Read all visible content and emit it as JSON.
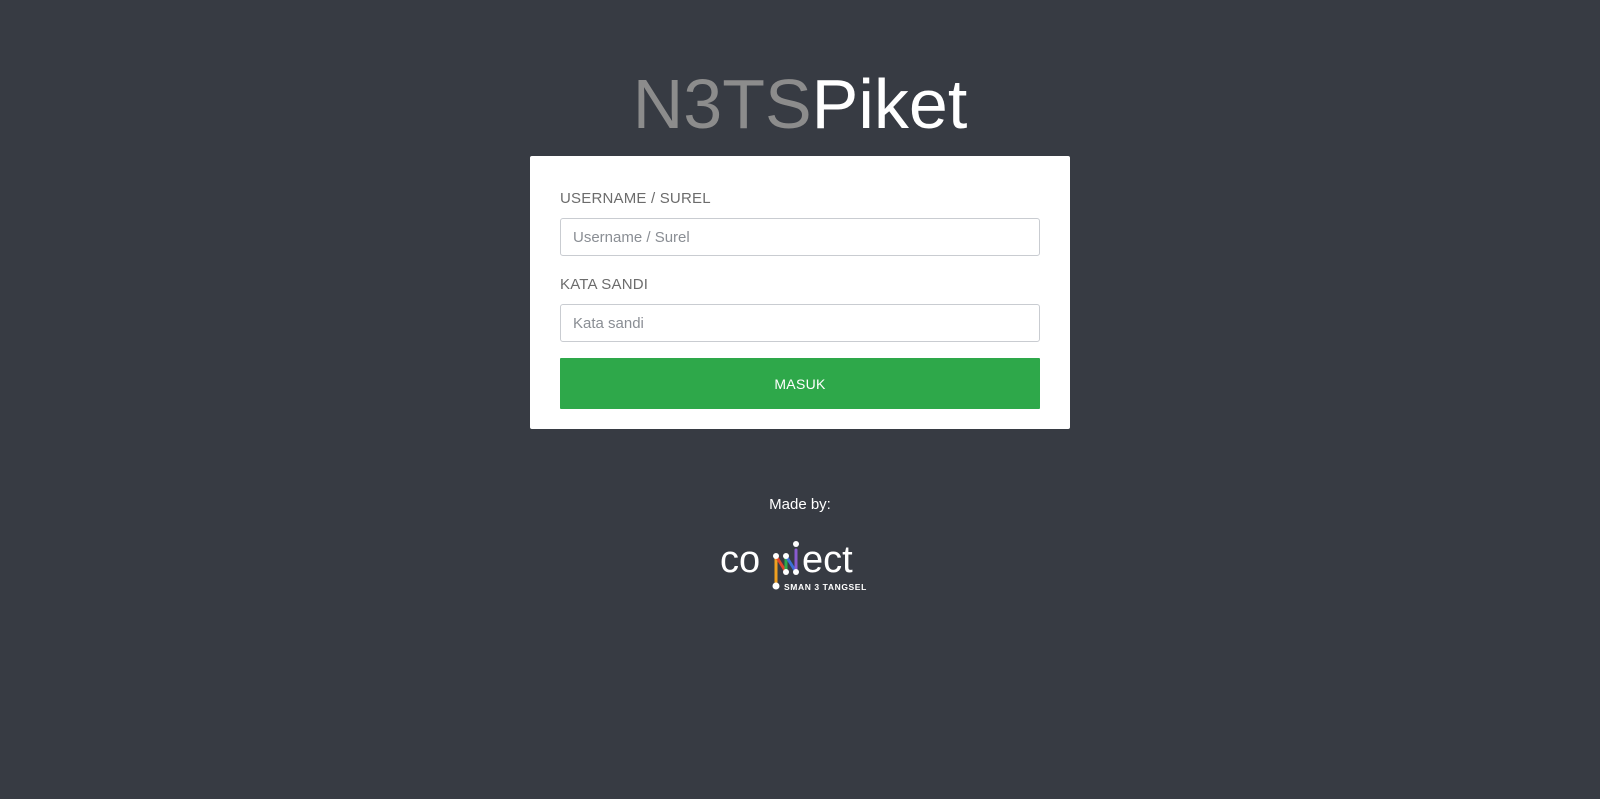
{
  "header": {
    "title_part_a": "N3TS",
    "title_part_b": "Piket"
  },
  "login_form": {
    "username_label": "USERNAME / SUREL",
    "username_placeholder": "Username / Surel",
    "username_value": "",
    "password_label": "KATA SANDI",
    "password_placeholder": "Kata sandi",
    "password_value": "",
    "submit_label": "MASUK"
  },
  "footer": {
    "made_by_label": "Made by:",
    "logo": {
      "wordmark": "connect",
      "subtitle": "SMAN 3 TANGSEL"
    }
  },
  "colors": {
    "background": "#373b43",
    "card": "#ffffff",
    "button": "#2ea84a",
    "title_muted": "#8c8c8c",
    "title_strong": "#ffffff"
  }
}
